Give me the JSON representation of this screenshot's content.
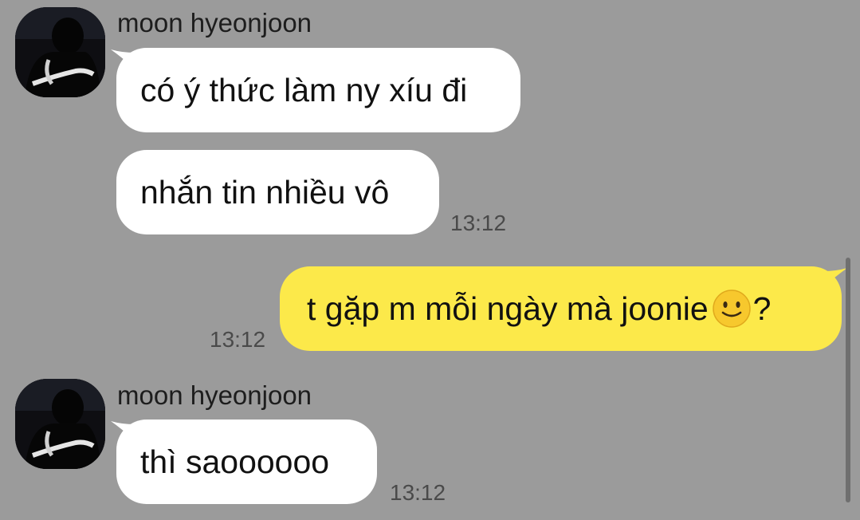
{
  "chat": {
    "groups": [
      {
        "sender": "moon hyeonjoon",
        "messages": [
          {
            "text": "có ý thức làm ny xíu đi"
          },
          {
            "text": "nhắn tin nhiều vô",
            "time": "13:12"
          }
        ]
      },
      {
        "mine": true,
        "messages": [
          {
            "text": "t gặp m mỗi ngày mà joonie ",
            "emoji": "slightly-smiling-face-icon",
            "suffix": "?",
            "time": "13:12"
          }
        ]
      },
      {
        "sender": "moon hyeonjoon",
        "messages": [
          {
            "text": "thì saoooooo",
            "time": "13:12"
          }
        ]
      }
    ]
  },
  "colors": {
    "background": "#9b9b9b",
    "incoming_bubble": "#ffffff",
    "outgoing_bubble": "#fce94a",
    "timestamp": "#4a4a4a"
  }
}
